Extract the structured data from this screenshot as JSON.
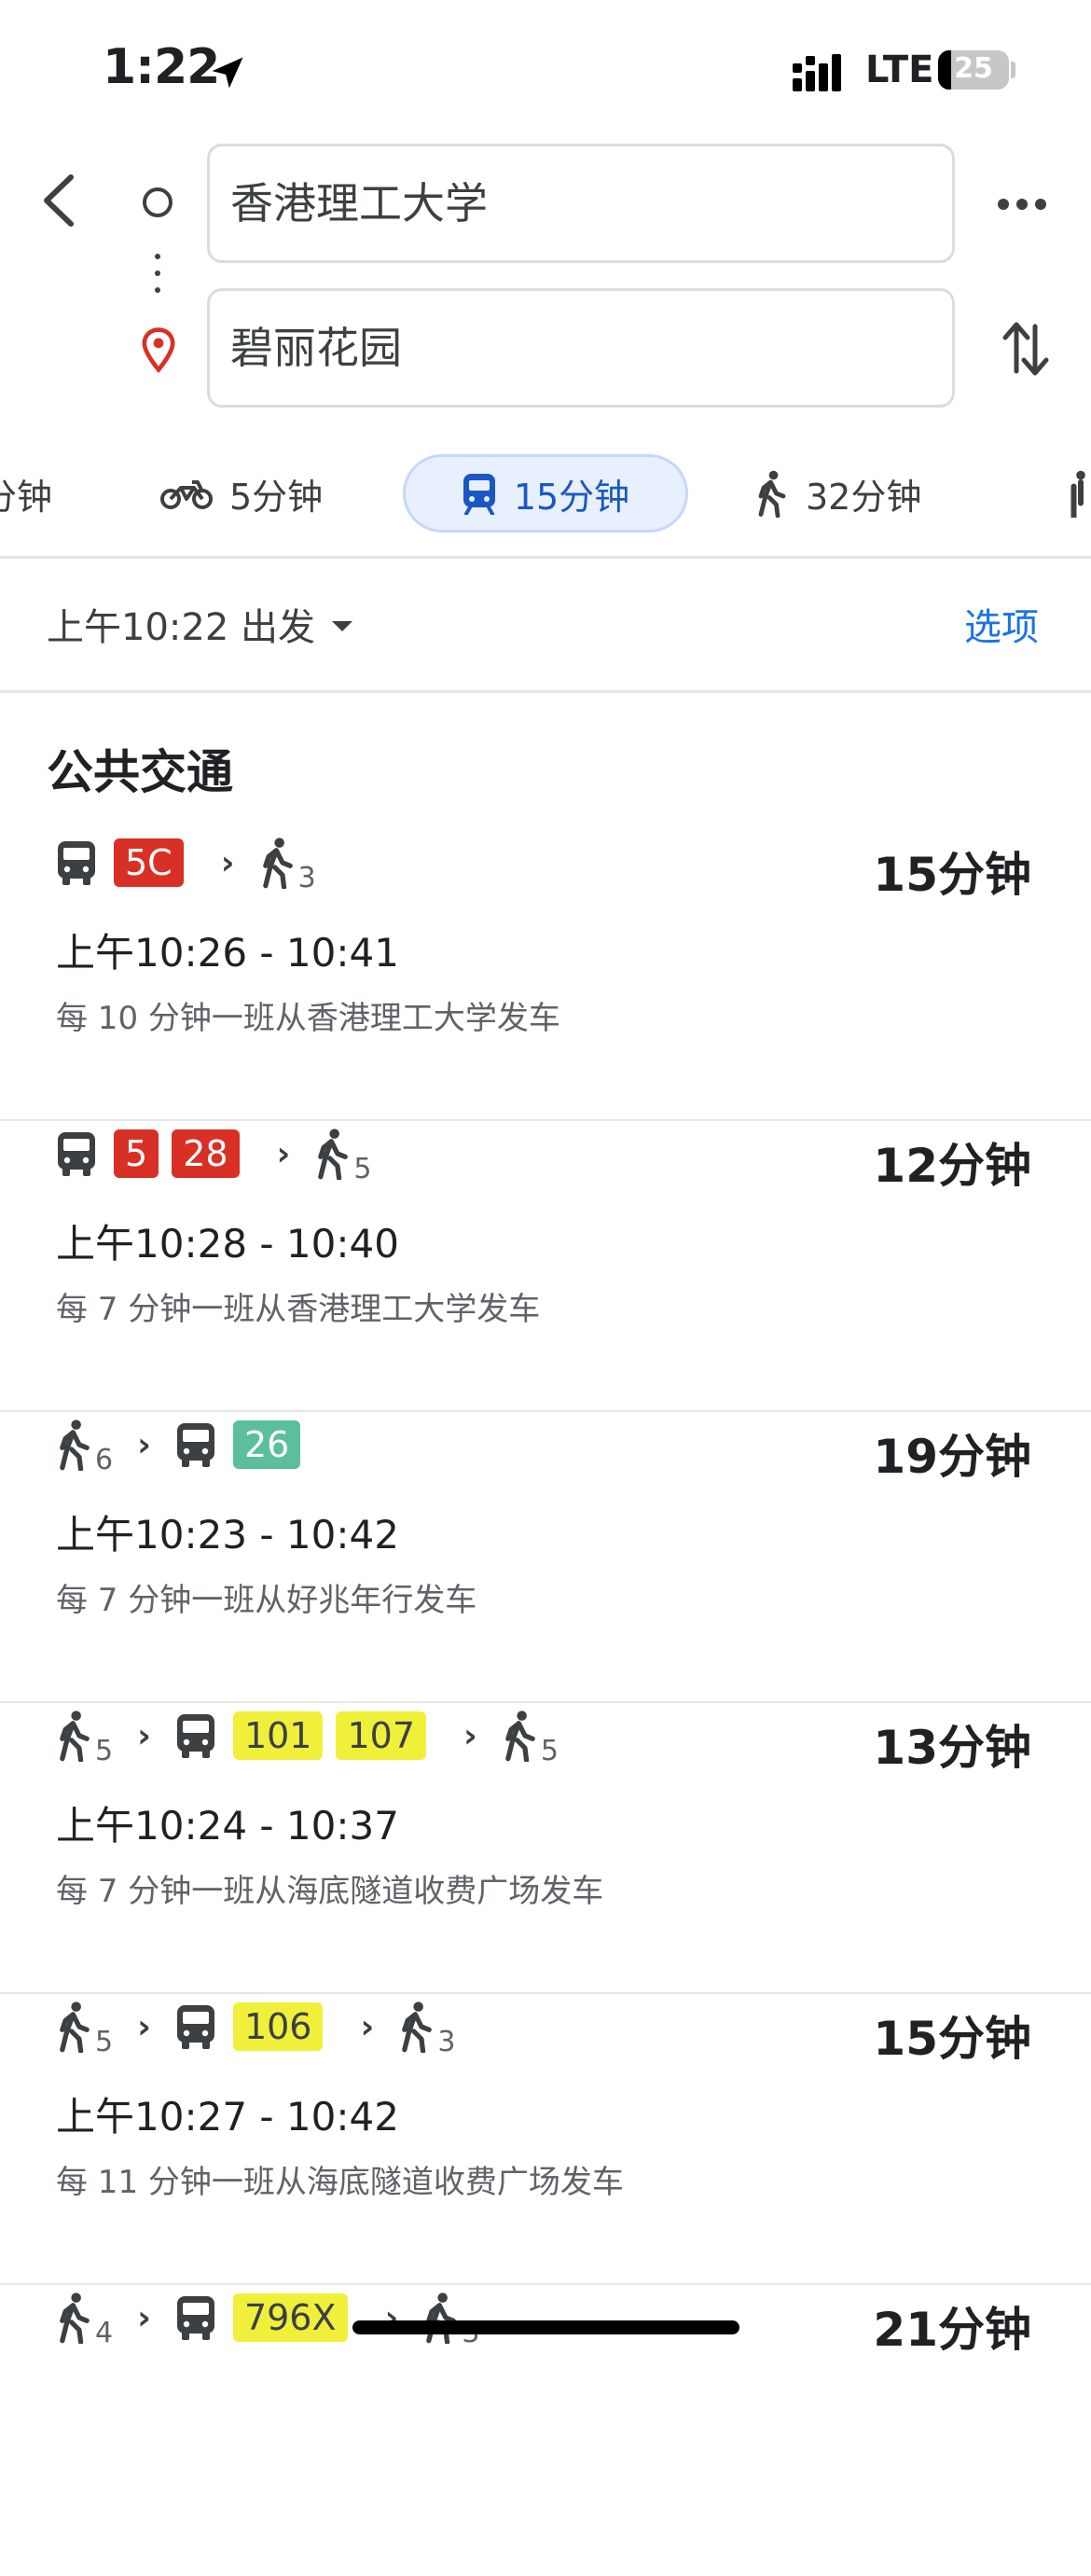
{
  "status_bar": {
    "time": "1:22",
    "network": "LTE",
    "battery": "25"
  },
  "search": {
    "origin": "香港理工大学",
    "destination": "碧丽花园"
  },
  "modes": [
    {
      "label": "分钟",
      "icon": "car-icon"
    },
    {
      "label": "5分钟",
      "icon": "motorcycle-icon"
    },
    {
      "label": "15分钟",
      "icon": "transit-icon",
      "selected": true
    },
    {
      "label": "32分钟",
      "icon": "walk-icon"
    },
    {
      "label": "",
      "icon": "ride-icon"
    }
  ],
  "depart": {
    "label": "上午10:22 出发",
    "options": "选项"
  },
  "section_title": "公共交通",
  "routes": [
    {
      "duration": "15分钟",
      "time": "上午10:26 - 10:41",
      "frequency": "每 10 分钟一班从香港理工大学发车",
      "steps": [
        {
          "type": "bus",
          "lines": [
            {
              "name": "5C",
              "color": "red"
            }
          ]
        },
        {
          "type": "walk",
          "minutes": "3"
        }
      ]
    },
    {
      "duration": "12分钟",
      "time": "上午10:28 - 10:40",
      "frequency": "每 7 分钟一班从香港理工大学发车",
      "steps": [
        {
          "type": "bus",
          "lines": [
            {
              "name": "5",
              "color": "red"
            },
            {
              "name": "28",
              "color": "red"
            }
          ]
        },
        {
          "type": "walk",
          "minutes": "5"
        }
      ]
    },
    {
      "duration": "19分钟",
      "time": "上午10:23 - 10:42",
      "frequency": "每 7 分钟一班从好兆年行发车",
      "steps": [
        {
          "type": "walk",
          "minutes": "6"
        },
        {
          "type": "bus",
          "lines": [
            {
              "name": "26",
              "color": "green"
            }
          ]
        }
      ]
    },
    {
      "duration": "13分钟",
      "time": "上午10:24 - 10:37",
      "frequency": "每 7 分钟一班从海底隧道收费广场发车",
      "steps": [
        {
          "type": "walk",
          "minutes": "5"
        },
        {
          "type": "bus",
          "lines": [
            {
              "name": "101",
              "color": "yellow"
            },
            {
              "name": "107",
              "color": "yellow"
            }
          ]
        },
        {
          "type": "walk",
          "minutes": "5"
        }
      ]
    },
    {
      "duration": "15分钟",
      "time": "上午10:27 - 10:42",
      "frequency": "每 11 分钟一班从海底隧道收费广场发车",
      "steps": [
        {
          "type": "walk",
          "minutes": "5"
        },
        {
          "type": "bus",
          "lines": [
            {
              "name": "106",
              "color": "yellow"
            }
          ]
        },
        {
          "type": "walk",
          "minutes": "3"
        }
      ]
    },
    {
      "duration": "21分钟",
      "time": "",
      "frequency": "",
      "steps": [
        {
          "type": "walk",
          "minutes": "4"
        },
        {
          "type": "bus",
          "lines": [
            {
              "name": "796X",
              "color": "yellow"
            }
          ]
        },
        {
          "type": "walk",
          "minutes": "3"
        }
      ]
    }
  ],
  "colors": {
    "accent": "#1a73e8",
    "red": "#d93025",
    "green": "#5bbf9c",
    "yellow": "#f0f03a"
  }
}
